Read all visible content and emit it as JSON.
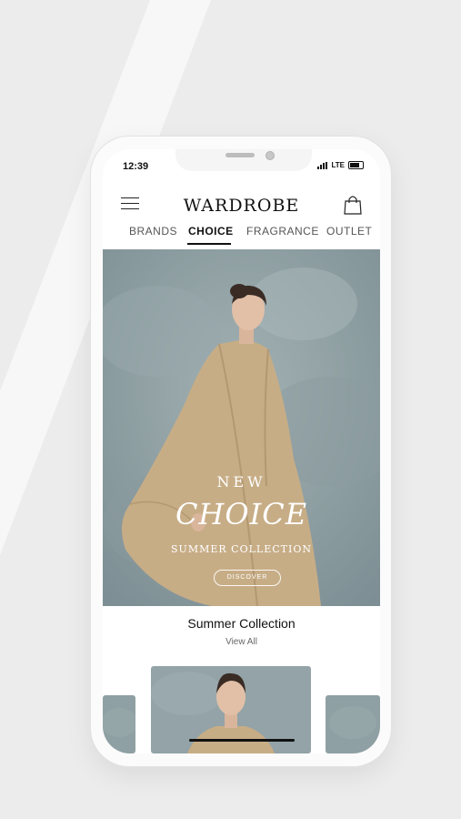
{
  "status_bar": {
    "time": "12:39",
    "network": "LTE"
  },
  "header": {
    "brand": "WARDROBE",
    "menu_icon": "hamburger-menu-icon",
    "bag_icon": "shopping-bag-icon"
  },
  "tabs": [
    {
      "label": "BRANDS"
    },
    {
      "label": "CHOICE",
      "active": true
    },
    {
      "label": "FRAGRANCE"
    },
    {
      "label": "OUTLET"
    }
  ],
  "hero": {
    "line1": "NEW",
    "line2": "CHOICE",
    "line3": "SUMMER COLLECTION",
    "button": "DISCOVER"
  },
  "collection": {
    "title": "Summer Collection",
    "view_all": "View All"
  },
  "colors": {
    "background": "#ececec",
    "hero_backdrop": "#8fa0a4",
    "coat": "#c9b089",
    "text": "#111111"
  }
}
